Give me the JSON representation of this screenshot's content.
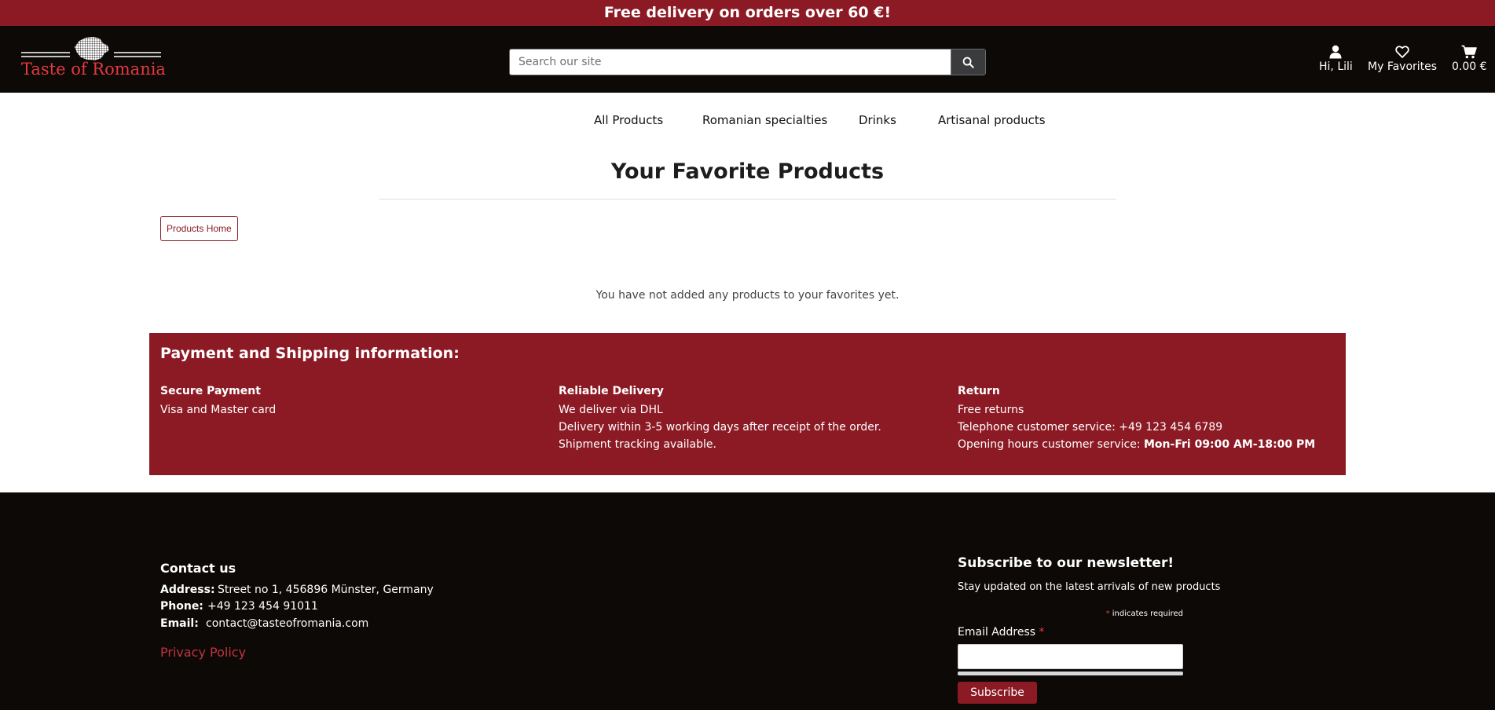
{
  "banner": {
    "text": "Free delivery on orders over 60 €!"
  },
  "header": {
    "logo_text": "Taste of Romania",
    "search": {
      "placeholder": "Search our site",
      "value": ""
    },
    "account_label": "Hi, Lili",
    "favorites_label": "My Favorites",
    "cart_label": "0.00 €"
  },
  "nav": {
    "items": [
      {
        "label": "All Products"
      },
      {
        "label": "Romanian specialties"
      },
      {
        "label": "Drinks"
      },
      {
        "label": "Artisanal products"
      }
    ]
  },
  "main": {
    "title": "Your Favorite Products",
    "home_button": "Products Home",
    "empty_message": "You have not added any products to your favorites yet."
  },
  "info": {
    "heading": "Payment and Shipping information:",
    "payment": {
      "title": "Secure Payment",
      "line1": "Visa and Master card"
    },
    "delivery": {
      "title": "Reliable Delivery",
      "line1": "We deliver via DHL",
      "line2": "Delivery within 3-5 working days after receipt of the order.",
      "line3": "Shipment tracking available."
    },
    "return": {
      "title": "Return",
      "line1": "Free returns",
      "line2": "Telephone customer service: +49 123 454 6789",
      "line3_prefix": "Opening hours customer service:",
      "line3_hours": "Mon-Fri 09:00 AM-18:00 PM"
    }
  },
  "footer": {
    "contact_heading": "Contact us",
    "address_label": "Address:",
    "address_value": "Street no 1, 456896 Münster, Germany",
    "phone_label": "Phone:",
    "phone_value": "+49 123 454 91011",
    "email_label": "Email:",
    "email_value": "contact@tasteofromania.com",
    "privacy_link": "Privacy Policy",
    "newsletter": {
      "heading": "Subscribe to our newsletter!",
      "subtitle": "Stay updated on the latest arrivals of new products",
      "required_star": "*",
      "required_note": "indicates required",
      "email_label": "Email Address",
      "email_value": "",
      "subscribe_label": "Subscribe"
    }
  },
  "colors": {
    "brand_red": "#8c1a25",
    "header_black": "#0c0906",
    "logo_red": "#e4393f"
  }
}
